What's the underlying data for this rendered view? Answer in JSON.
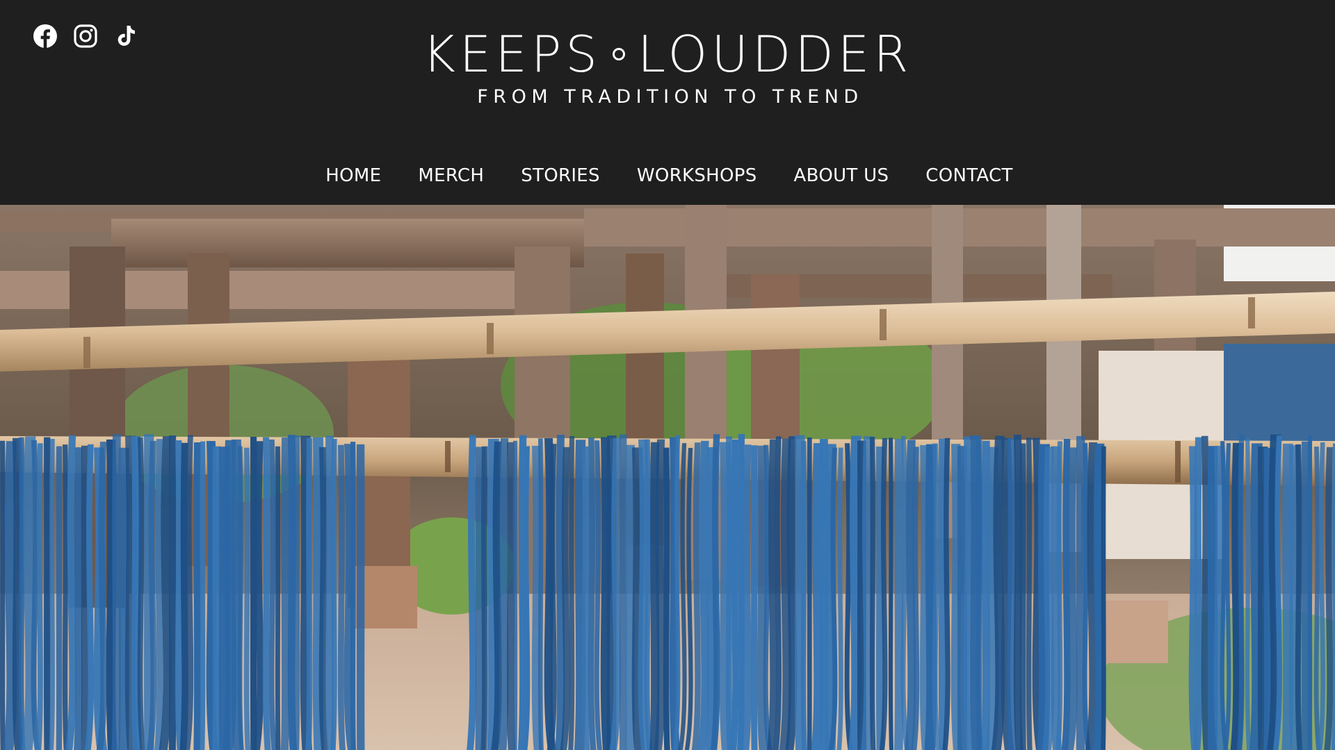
{
  "brand": {
    "title_left": "KEEPS",
    "title_right": "LOUDDER",
    "tagline": "FROM TRADITION TO TREND"
  },
  "social": [
    {
      "name": "facebook-icon",
      "label": "Facebook"
    },
    {
      "name": "instagram-icon",
      "label": "Instagram"
    },
    {
      "name": "tiktok-icon",
      "label": "TikTok"
    }
  ],
  "nav": {
    "home": "HOME",
    "merch": "MERCH",
    "stories": "STORIES",
    "workshops": "WORKSHOPS",
    "about": "ABOUT US",
    "contact": "CONTACT"
  },
  "hero": {
    "image_subject": "indigo-dyed yarn drying on bamboo poles"
  },
  "colors": {
    "header_bg": "#1f1f1f",
    "text": "#ffffff",
    "indigo": "#2a64a3"
  }
}
